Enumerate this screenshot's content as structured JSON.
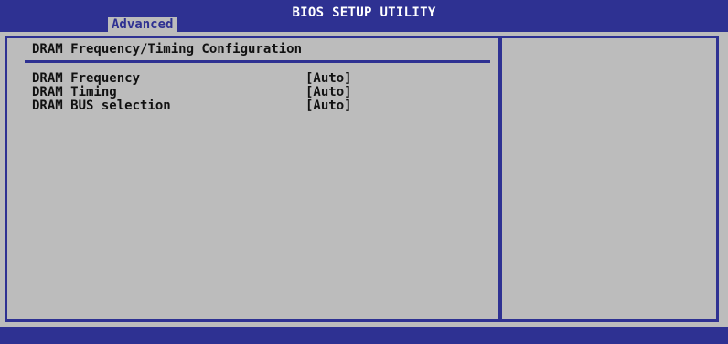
{
  "window": {
    "title": "BIOS SETUP UTILITY"
  },
  "tabs": {
    "active_label": "Advanced"
  },
  "main": {
    "section_title": "DRAM Frequency/Timing Configuration",
    "items": [
      {
        "label": "DRAM Frequency",
        "value": "[Auto]"
      },
      {
        "label": "DRAM Timing",
        "value": "[Auto]"
      },
      {
        "label": "DRAM BUS selection",
        "value": "[Auto]"
      }
    ]
  },
  "colors": {
    "bios_blue": "#2e3192",
    "panel_gray": "#bcbcbc",
    "text": "#111111",
    "title_text": "#ffffff"
  }
}
